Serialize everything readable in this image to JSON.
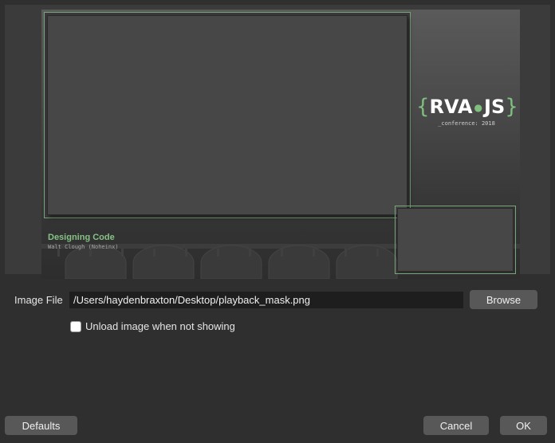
{
  "preview": {
    "brand_left": "{",
    "brand_first": "RVA",
    "brand_dot": "●",
    "brand_second": "JS",
    "brand_right": "}",
    "brand_subtitle": "_conference: 2018",
    "talk_title": "Designing Code",
    "talk_speaker": "Walt Clough (Noheinx)"
  },
  "form": {
    "image_file_label": "Image File",
    "image_file_value": "/Users/haydenbraxton/Desktop/playback_mask.png",
    "browse_label": "Browse",
    "unload_checkbox_label": "Unload image when not showing",
    "unload_checked": false
  },
  "footer": {
    "defaults_label": "Defaults",
    "cancel_label": "Cancel",
    "ok_label": "OK"
  },
  "colors": {
    "accent_green": "#79a679",
    "background": "#2f2f2f",
    "button": "#585858"
  }
}
